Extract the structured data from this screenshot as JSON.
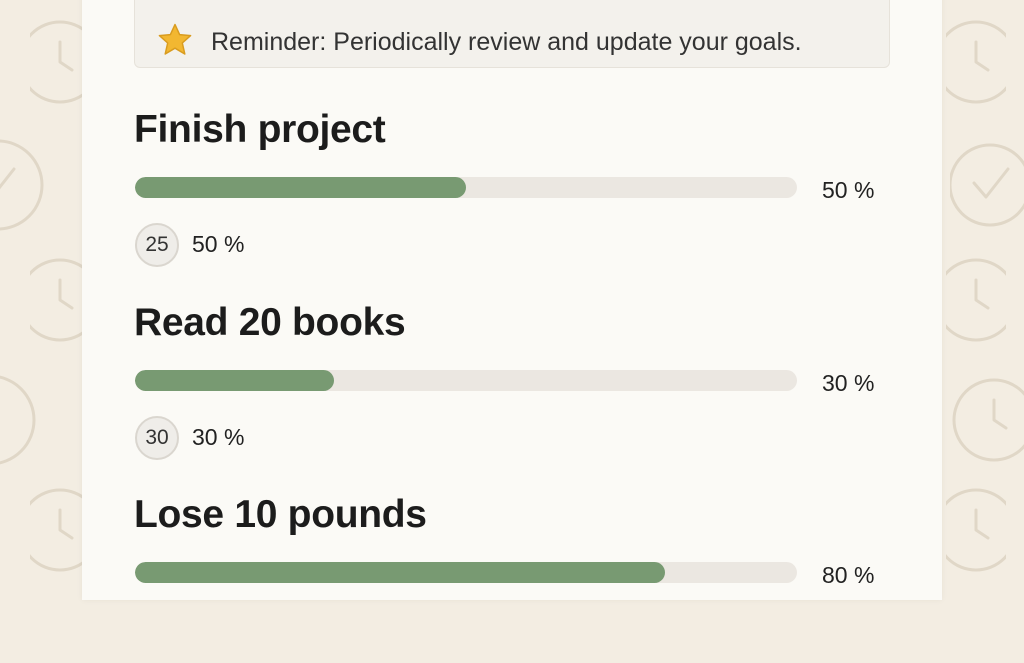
{
  "reminder": {
    "icon": "star-icon",
    "text": "Reminder: Periodically review and update your goals."
  },
  "colors": {
    "progress_fill": "#789a72",
    "progress_track": "#ebe7e1",
    "star": "#f2b731"
  },
  "goals": [
    {
      "title": "Finish project",
      "progress": 50,
      "progress_label": "50 %",
      "badge": "25",
      "badge_label": "50 %"
    },
    {
      "title": "Read 20 books",
      "progress": 30,
      "progress_label": "30 %",
      "badge": "30",
      "badge_label": "30 %"
    },
    {
      "title": "Lose 10 pounds",
      "progress": 80,
      "progress_label": "80 %"
    }
  ]
}
